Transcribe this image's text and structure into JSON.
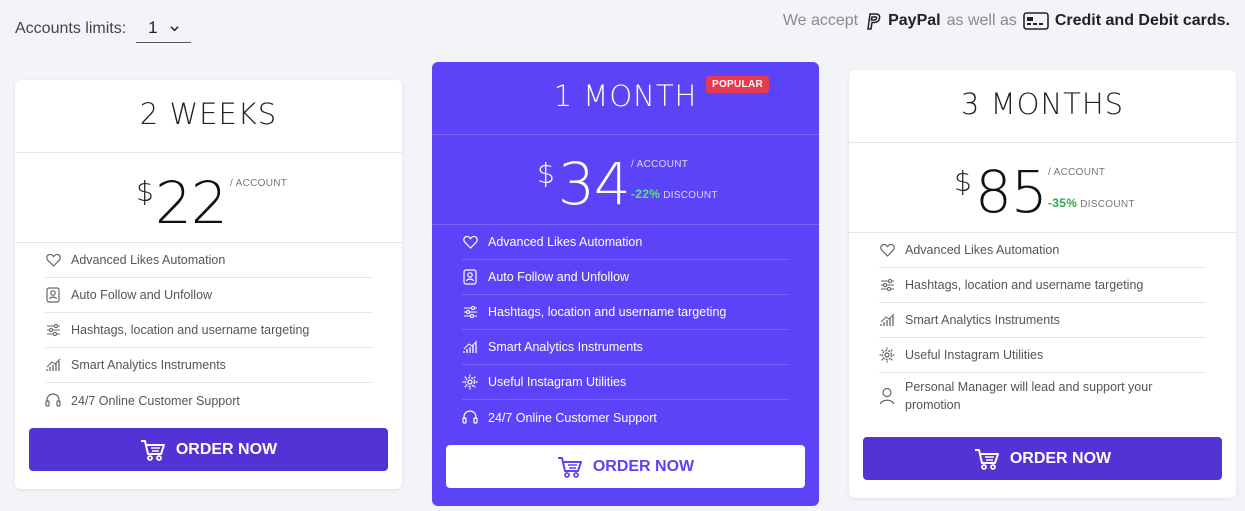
{
  "accounts_limit": {
    "label": "Accounts limits:",
    "value": "1"
  },
  "payments": {
    "prefix": "We accept",
    "paypal": "PayPal",
    "middle": "as well as",
    "cards": "Credit and Debit cards."
  },
  "plans": [
    {
      "title": "2 WEEKS",
      "currency": "$",
      "price": "22",
      "per": "/ ACCOUNT",
      "features": [
        {
          "icon": "heart-icon",
          "label": "Advanced Likes Automation"
        },
        {
          "icon": "follow-icon",
          "label": "Auto Follow and Unfollow"
        },
        {
          "icon": "sliders-icon",
          "label": "Hashtags, location and username targeting"
        },
        {
          "icon": "analytics-icon",
          "label": "Smart Analytics Instruments"
        },
        {
          "icon": "headset-icon",
          "label": "24/7 Online Customer Support"
        }
      ],
      "button": "ORDER NOW"
    },
    {
      "title": "1 MONTH",
      "badge": "POPULAR",
      "currency": "$",
      "price": "34",
      "per": "/ ACCOUNT",
      "discount_pct": "-22%",
      "discount_label": "DISCOUNT",
      "features": [
        {
          "icon": "heart-icon",
          "label": "Advanced Likes Automation"
        },
        {
          "icon": "follow-icon",
          "label": "Auto Follow and Unfollow"
        },
        {
          "icon": "sliders-icon",
          "label": "Hashtags, location and username targeting"
        },
        {
          "icon": "analytics-icon",
          "label": "Smart Analytics Instruments"
        },
        {
          "icon": "gear-icon",
          "label": "Useful Instagram Utilities"
        },
        {
          "icon": "headset-icon",
          "label": "24/7 Online Customer Support"
        }
      ],
      "button": "ORDER NOW"
    },
    {
      "title": "3 MONTHS",
      "currency": "$",
      "price": "85",
      "per": "/ ACCOUNT",
      "discount_pct": "-35%",
      "discount_label": "DISCOUNT",
      "features": [
        {
          "icon": "heart-icon",
          "label": "Advanced Likes Automation"
        },
        {
          "icon": "sliders-icon",
          "label": "Hashtags, location and username targeting"
        },
        {
          "icon": "analytics-icon",
          "label": "Smart Analytics Instruments"
        },
        {
          "icon": "gear-icon",
          "label": "Useful Instagram Utilities"
        },
        {
          "icon": "person-icon",
          "label": "Personal Manager will lead and support your promotion"
        }
      ],
      "button": "ORDER NOW"
    }
  ],
  "colors": {
    "accent": "#5b43f7",
    "button": "#5233d6",
    "badge": "#e53a4f",
    "discount": "#2fa84f"
  }
}
